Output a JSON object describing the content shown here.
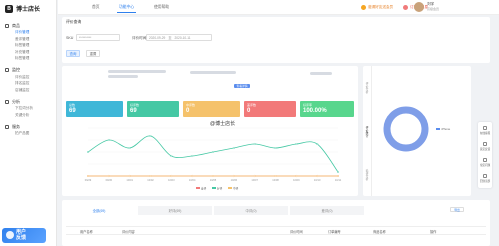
{
  "brand": {
    "name": "博士店长",
    "logo_glyph": "B"
  },
  "sidebar": {
    "sections": [
      {
        "title": "商品",
        "icon": "box-icon",
        "items": [
          {
            "label": "评价管理",
            "active": true
          },
          {
            "label": "差评管理",
            "active": false
          },
          {
            "label": "标签管理",
            "active": false
          },
          {
            "label": "补充管理",
            "active": false
          },
          {
            "label": "标签管理",
            "active": false
          }
        ]
      },
      {
        "title": "监控",
        "icon": "monitor-icon",
        "items": [
          {
            "label": "评价监控",
            "active": false
          },
          {
            "label": "排名监控",
            "active": false
          },
          {
            "label": "店铺监控",
            "active": false
          }
        ]
      },
      {
        "title": "分析",
        "icon": "chart-icon",
        "items": [
          {
            "label": "下拉词分析",
            "active": false
          },
          {
            "label": "关键分析",
            "active": false
          }
        ]
      },
      {
        "title": "服务",
        "icon": "service-icon",
        "items": [
          {
            "label": "拍产品图",
            "active": false
          }
        ]
      }
    ],
    "promo_line1": "用户",
    "promo_line2": "反馈"
  },
  "topbar": {
    "tabs": [
      "首页",
      "功能中心",
      "使用帮助"
    ],
    "active_tab": "功能中心",
    "link1": "邀请好友送会员",
    "link2": "订阅好消息",
    "user_name": "刘宇",
    "user_sub": "高级会员"
  },
  "filter": {
    "title": "评价查询",
    "sku_label": "SKU",
    "sku_value": "**********",
    "time_label": "评价时间",
    "date_start": "2020-09-29",
    "date_sep": "至",
    "date_end": "2020-10-11",
    "query_button": "查询",
    "reset_button": "重置"
  },
  "main": {
    "detail_button": "查看详情",
    "watermark": "@博士店长",
    "kpis": [
      {
        "label": "总数",
        "value": "69",
        "color": "#3fb7d8"
      },
      {
        "label": "好评数",
        "value": "69",
        "color": "#45c8a4"
      },
      {
        "label": "中评数",
        "value": "0",
        "color": "#f5c26b"
      },
      {
        "label": "差评数",
        "value": "0",
        "color": "#f27979"
      },
      {
        "label": "好评率",
        "value": "100.00%",
        "color": "#58d68d"
      }
    ],
    "legend": [
      "差评",
      "好评",
      "中评"
    ]
  },
  "chart_data": {
    "type": "line",
    "categories": [
      "09/29",
      "09/30",
      "10/01",
      "10/02",
      "10/03",
      "10/04",
      "10/05",
      "10/06",
      "10/07",
      "10/08",
      "10/09",
      "10/10",
      "10/11"
    ],
    "series": [
      {
        "name": "好评",
        "color": "#45c8a4",
        "values": [
          6,
          9,
          7,
          10,
          5,
          5,
          6,
          7,
          8,
          7,
          8,
          8,
          1
        ]
      },
      {
        "name": "中评",
        "color": "#f5c26b",
        "values": [
          0,
          0,
          0,
          0,
          0,
          0,
          0,
          0,
          0,
          0,
          0,
          0,
          0
        ]
      },
      {
        "name": "差评",
        "color": "#f27979",
        "values": [
          0,
          0,
          0,
          0,
          0,
          0,
          0,
          0,
          0,
          0,
          0,
          0,
          0
        ]
      }
    ],
    "ylim": [
      0,
      12
    ]
  },
  "side": {
    "vtabs": [
      "评价分析",
      "评价统计",
      "追评分析"
    ],
    "legend": "iPhone",
    "donut_color": "#7f9ee8"
  },
  "float_bar": [
    "在线客服",
    "意见反馈",
    "常见问题",
    "回到顶部"
  ],
  "bottom": {
    "tabs": [
      "全部(69)",
      "好评(69)",
      "中评(0)",
      "差评(0)"
    ],
    "more_button": "导出",
    "columns": [
      "用户名称",
      "评价内容",
      "评价时间",
      "订单编号",
      "商品名称",
      "操作"
    ]
  }
}
